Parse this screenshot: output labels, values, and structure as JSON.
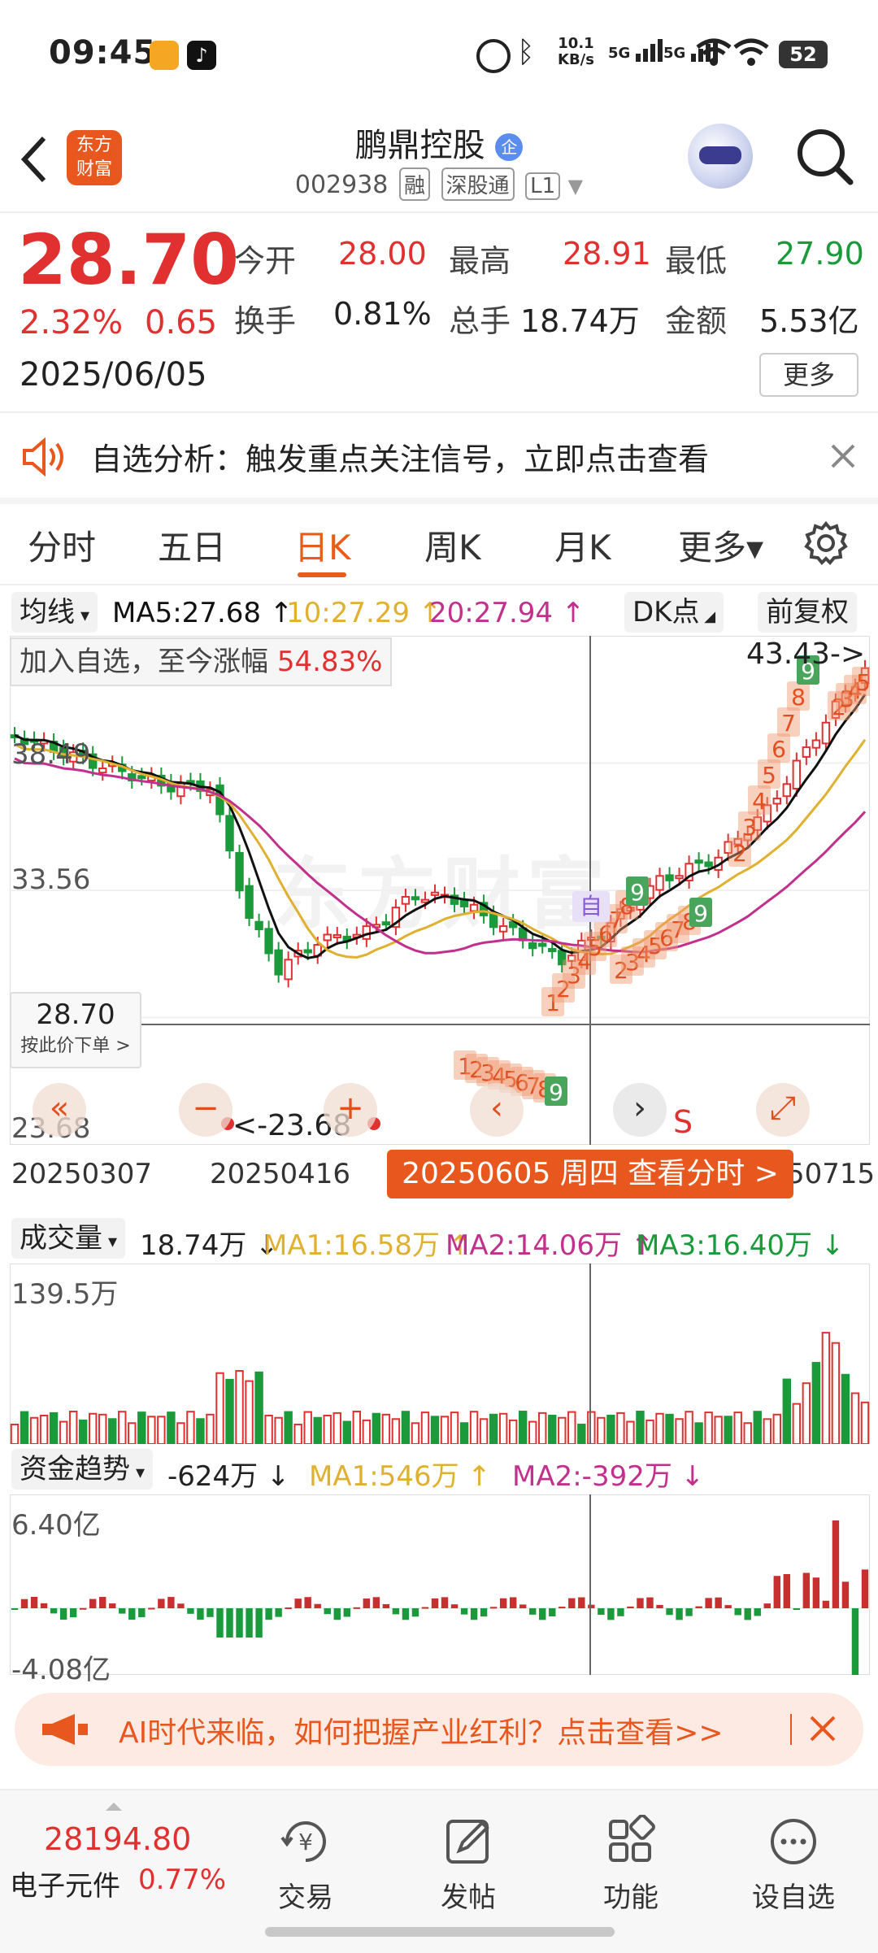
{
  "status_bar": {
    "time": "09:45",
    "net_speed_top": "10.1",
    "net_speed_bottom": "KB/s",
    "signal1": "5G",
    "signal2": "5G",
    "battery": "52"
  },
  "header": {
    "logo_line1": "东方",
    "logo_line2": "财富",
    "title": "鹏鼎控股",
    "badge": "企",
    "code": "002938",
    "tag_margin": "融",
    "tag_connect": "深股通",
    "tag_level": "L1"
  },
  "quote": {
    "price": "28.70",
    "change_pct": "2.32%",
    "change_abs": "0.65",
    "date": "2025/06/05",
    "open_label": "今开",
    "open": "28.00",
    "high_label": "最高",
    "high": "28.91",
    "low_label": "最低",
    "low": "27.90",
    "turnover_label": "换手",
    "turnover": "0.81%",
    "volume_label": "总手",
    "volume": "18.74万",
    "amount_label": "金额",
    "amount": "5.53亿",
    "more_label": "更多"
  },
  "signal": {
    "text": "自选分析：触发重点关注信号，立即点击查看"
  },
  "tabs": [
    {
      "label": "分时",
      "active": false
    },
    {
      "label": "五日",
      "active": false
    },
    {
      "label": "日K",
      "active": true
    },
    {
      "label": "周K",
      "active": false
    },
    {
      "label": "月K",
      "active": false
    },
    {
      "label": "更多▾",
      "active": false
    }
  ],
  "kline": {
    "indicator": "均线",
    "ma5": "MA5:27.68 ↑",
    "ma10": "10:27.29 ↑",
    "ma20": "20:27.94 ↑",
    "dk_button": "DK点",
    "fq_button": "前复权",
    "join_text": "加入自选，至今涨幅",
    "join_pct": "54.83%",
    "top_marker": "43.43->",
    "y_labels": [
      "38.49",
      "33.56",
      "23.68"
    ],
    "price_box": "28.70",
    "price_box_sub": "按此价下单 >",
    "low_marker": "<-23.68",
    "auto_tag": "自",
    "sell_tag": "S",
    "x_labels": [
      "20250307",
      "20250416",
      "50715"
    ],
    "date_banner": "20250605 周四  查看分时 >",
    "ctrl_left": "«",
    "ctrl_minus": "−",
    "ctrl_plus": "+",
    "ctrl_prev": "‹",
    "ctrl_next": "›",
    "ctrl_full": "⤢",
    "watermark": "东方财富",
    "td_down": [
      "1",
      "2",
      "3",
      "4",
      "5",
      "6",
      "7",
      "8",
      "9"
    ],
    "td_up1": [
      "1",
      "2",
      "3",
      "4",
      "5",
      "6",
      "7",
      "8",
      "9"
    ],
    "td_up2": [
      "2",
      "3",
      "4",
      "5",
      "6",
      "7",
      "8",
      "9"
    ],
    "td_up3": [
      "2",
      "3",
      "4",
      "5",
      "6",
      "7",
      "8",
      "9"
    ],
    "td_up4": [
      "2",
      "3",
      "4",
      "5"
    ]
  },
  "volume": {
    "label": "成交量",
    "value": "18.74万 ↓",
    "ma1": "MA1:16.58万 ↑",
    "ma2": "MA2:14.06万 ↑",
    "ma3": "MA3:16.40万 ↓",
    "y_label": "139.5万"
  },
  "capital": {
    "label": "资金趋势",
    "value": "-624万 ↓",
    "ma1": "MA1:546万 ↑",
    "ma2": "MA2:-392万 ↓",
    "y_top": "6.40亿",
    "y_bottom": "-4.08亿"
  },
  "ad": {
    "text": "AI时代来临，如何把握产业红利？点击查看>>"
  },
  "bottom_nav": {
    "index_value": "28194.80",
    "index_name": "电子元件",
    "index_pct": "0.77%",
    "items": [
      {
        "label": "交易"
      },
      {
        "label": "发帖"
      },
      {
        "label": "功能"
      },
      {
        "label": "设自选"
      }
    ]
  },
  "colors": {
    "up": "#e03030",
    "down": "#1a9a3a",
    "accent": "#e85d1a",
    "ma5": "#111111",
    "ma10": "#e0b030",
    "ma20": "#c0308c"
  }
}
